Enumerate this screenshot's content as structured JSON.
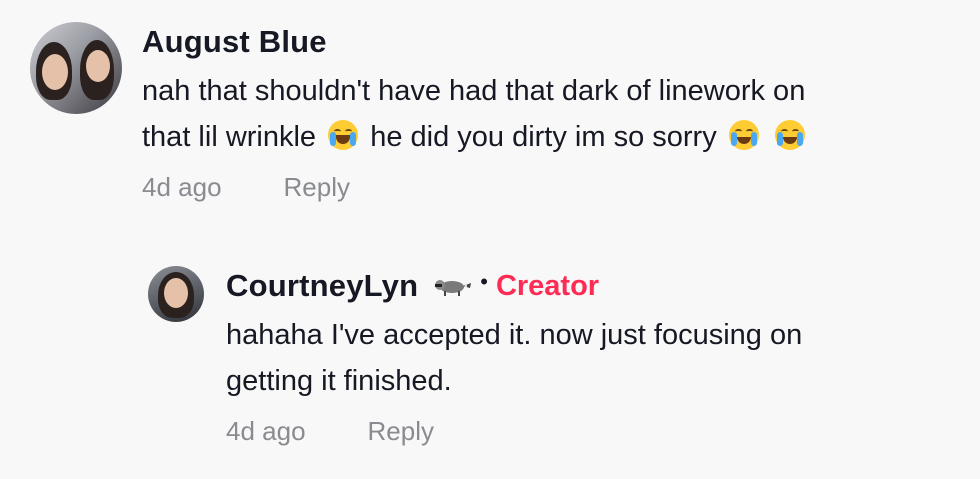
{
  "comments": [
    {
      "username": "August Blue",
      "text_line1": "nah that shouldn't have had that dark of linework on",
      "text_line2_a": "that lil wrinkle",
      "text_line2_b": "he did you dirty im so sorry",
      "emojis": [
        "face-with-tears-of-joy-icon",
        "loudly-crying-face-icon",
        "loudly-crying-face-icon"
      ],
      "time": "4d ago",
      "reply_label": "Reply"
    },
    {
      "username": "CourtneyLyn",
      "separator": "•",
      "badge": "Creator",
      "badge_color": "#fe2c55",
      "text_line1": "hahaha I've accepted it. now just focusing on",
      "text_line2": "getting it finished.",
      "time": "4d ago",
      "reply_label": "Reply"
    }
  ]
}
